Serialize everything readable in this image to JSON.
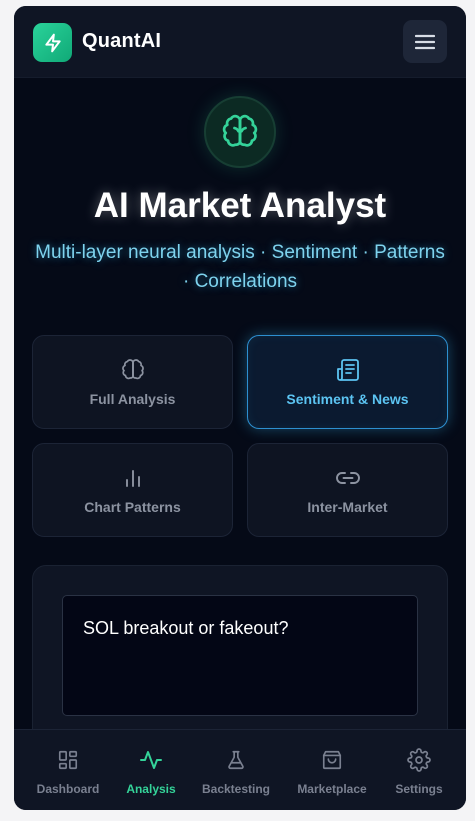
{
  "header": {
    "app_name": "QuantAI",
    "logo_icon": "lightning-bolt-icon",
    "menu_icon": "hamburger-menu-icon"
  },
  "hero": {
    "icon": "brain-icon",
    "title": "AI Market Analyst",
    "subtitle": "Multi-layer neural analysis · Sentiment · Patterns · Correlations"
  },
  "modes": [
    {
      "label": "Full Analysis",
      "icon": "brain-icon",
      "active": false
    },
    {
      "label": "Sentiment & News",
      "icon": "newspaper-icon",
      "active": true
    },
    {
      "label": "Chart Patterns",
      "icon": "bar-chart-icon",
      "active": false
    },
    {
      "label": "Inter-Market",
      "icon": "link-icon",
      "active": false
    }
  ],
  "query": {
    "value": "SOL breakout or fakeout?"
  },
  "nav": [
    {
      "label": "Dashboard",
      "icon": "grid-icon",
      "active": false
    },
    {
      "label": "Analysis",
      "icon": "activity-pulse-icon",
      "active": true
    },
    {
      "label": "Backtesting",
      "icon": "flask-icon",
      "active": false
    },
    {
      "label": "Marketplace",
      "icon": "shopping-bag-icon",
      "active": false
    },
    {
      "label": "Settings",
      "icon": "gear-icon",
      "active": false
    }
  ],
  "colors": {
    "background": "#050a17",
    "accent_green": "#34d399",
    "accent_blue": "#38bdf8",
    "card": "#0e1422"
  }
}
